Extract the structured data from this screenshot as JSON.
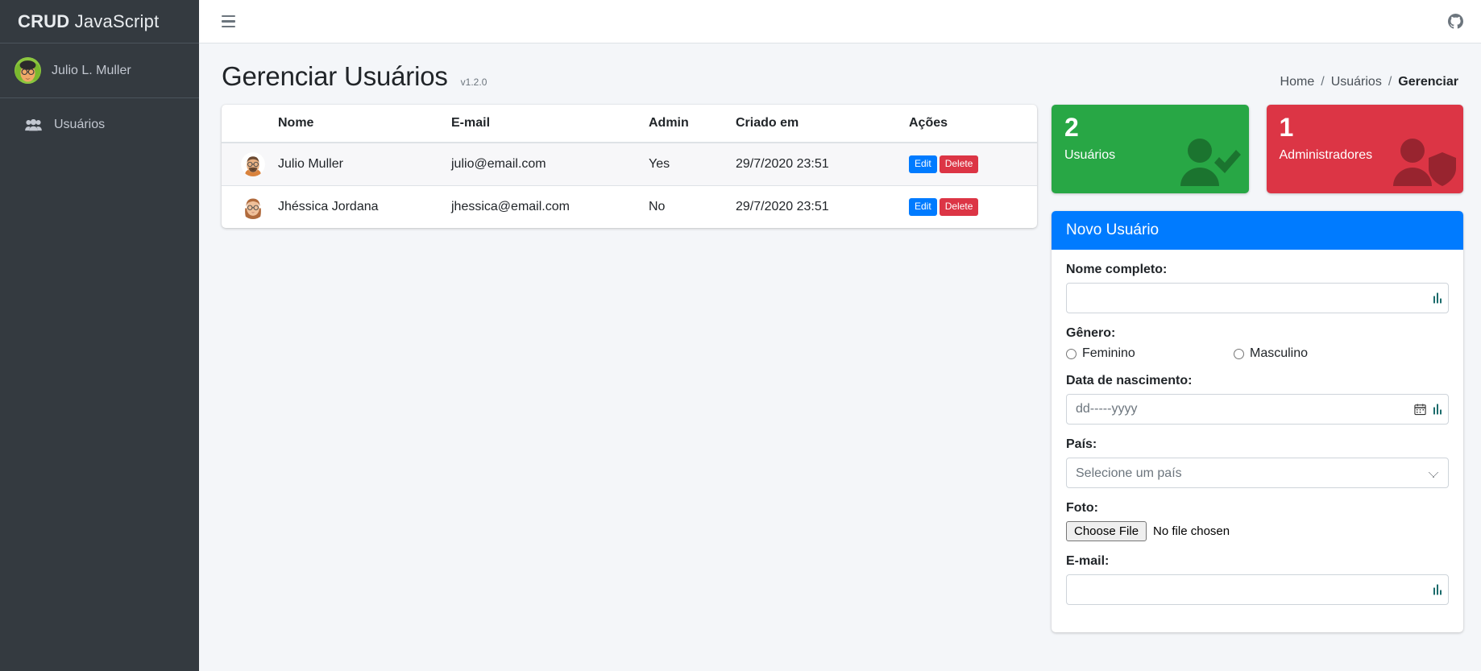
{
  "sidebar": {
    "brand_bold": "CRUD",
    "brand_light": " JavaScript",
    "user_name": "Julio L. Muller",
    "nav": [
      {
        "label": "Usuários",
        "icon": "users-icon"
      }
    ]
  },
  "topbar": {
    "menu_icon": "hamburger-icon",
    "github_icon": "github-icon"
  },
  "header": {
    "title": "Gerenciar Usuários",
    "version": "v1.2.0",
    "breadcrumb": {
      "home": "Home",
      "sep1": "/",
      "usuarios": "Usuários",
      "sep2": "/",
      "current": "Gerenciar"
    }
  },
  "table": {
    "columns": [
      "",
      "Nome",
      "E-mail",
      "Admin",
      "Criado em",
      "Ações"
    ],
    "rows": [
      {
        "nome": "Julio Muller",
        "email": "julio@email.com",
        "admin": "Yes",
        "criado_em": "29/7/2020 23:51",
        "edit_label": "Edit",
        "delete_label": "Delete"
      },
      {
        "nome": "Jhéssica Jordana",
        "email": "jhessica@email.com",
        "admin": "No",
        "criado_em": "29/7/2020 23:51",
        "edit_label": "Edit",
        "delete_label": "Delete"
      }
    ]
  },
  "stats": [
    {
      "value": "2",
      "label": "Usuários",
      "color": "#28a745",
      "icon": "user-check-icon"
    },
    {
      "value": "1",
      "label": "Administradores",
      "color": "#dc3545",
      "icon": "user-shield-icon"
    }
  ],
  "form": {
    "title": "Novo Usuário",
    "name_label": "Nome completo:",
    "name_value": "",
    "name_placeholder": "",
    "gender_label": "Gênero:",
    "gender_female": "Feminino",
    "gender_male": "Masculino",
    "birth_label": "Data de nascimento:",
    "birth_placeholder": "dd-----yyyy",
    "birth_value": "",
    "country_label": "País:",
    "country_selected": "Selecione um país",
    "photo_label": "Foto:",
    "photo_button": "Choose File",
    "photo_status": "No file chosen",
    "email_label": "E-mail:",
    "email_value": "",
    "email_placeholder": ""
  },
  "colors": {
    "sidebar_bg": "#343a40",
    "content_bg": "#f4f6f9",
    "primary": "#007bff",
    "success": "#28a745",
    "danger": "#dc3545"
  }
}
